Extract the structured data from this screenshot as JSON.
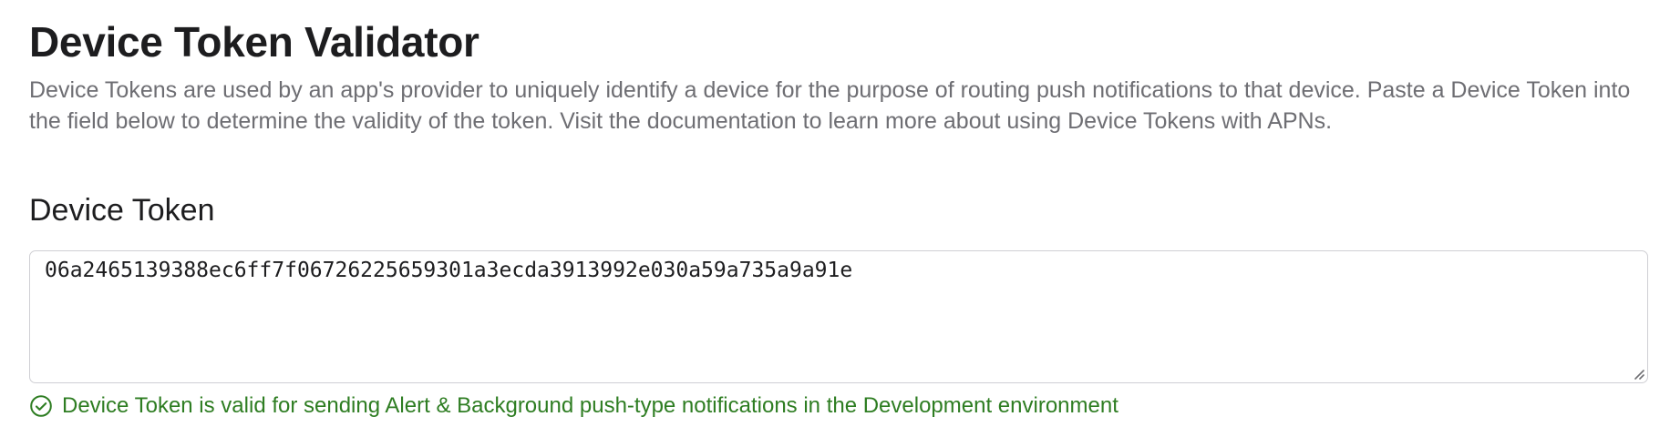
{
  "page": {
    "title": "Device Token Validator",
    "description": "Device Tokens are used by an app's provider to uniquely identify a device for the purpose of routing push notifications to that device. Paste a Device Token into the field below to determine the validity of the token. Visit the documentation to learn more about using Device Tokens with APNs."
  },
  "token_section": {
    "title": "Device Token",
    "value": "06a2465139388ec6ff7f06726225659301a3ecda3913992e030a59a735a9a91e"
  },
  "status": {
    "icon": "check-circle-icon",
    "message": "Device Token is valid for sending Alert & Background push-type notifications in the Development environment",
    "color": "#2e7d22"
  },
  "colors": {
    "title": "#1d1d1f",
    "description": "#6e6e73",
    "border": "#cfcfd4",
    "success": "#2e7d22"
  }
}
